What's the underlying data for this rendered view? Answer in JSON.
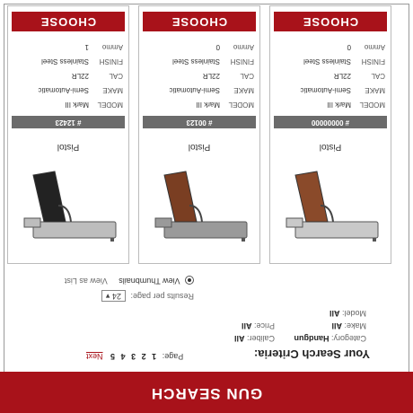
{
  "header": {
    "title": "GUN SEARCH"
  },
  "criteria": {
    "title": "Your Search Criteria:",
    "lines": [
      {
        "label": "Category:",
        "value": "Handgun"
      },
      {
        "label": "Make:",
        "value": "All"
      },
      {
        "label": "Model:",
        "value": "All"
      },
      {
        "label": "Caliber:",
        "value": "All"
      },
      {
        "label": "Price:",
        "value": "All"
      },
      {
        "label": "Results per page:",
        "value": "24"
      }
    ],
    "pager": {
      "label": "Page:",
      "pages": [
        "1",
        "2",
        "3",
        "4",
        "5"
      ],
      "next": "Next"
    },
    "view": {
      "thumbnails": "View Thumbnails",
      "list": "View as List"
    }
  },
  "products": [
    {
      "name": "Pistol",
      "id": "# 00000000",
      "specs": [
        {
          "l": "MODEL",
          "v": "Mark III"
        },
        {
          "l": "MAKE",
          "v": "Semi-Automatic"
        },
        {
          "l": "CAL",
          "v": "22LR"
        },
        {
          "l": "FINISH",
          "v": "Stainless Steel"
        },
        {
          "l": "Ammo",
          "v": "0"
        }
      ],
      "choose": "CHOOSE",
      "colors": {
        "body": "#c9c9c9",
        "grip": "#8a4a2a"
      }
    },
    {
      "name": "Pistol",
      "id": "# 00123",
      "specs": [
        {
          "l": "MODEL",
          "v": "Mark III"
        },
        {
          "l": "MAKE",
          "v": "Semi-Automatic"
        },
        {
          "l": "CAL",
          "v": "22LR"
        },
        {
          "l": "FINISH",
          "v": "Stainless Steel"
        },
        {
          "l": "Ammo",
          "v": "0"
        }
      ],
      "choose": "CHOOSE",
      "colors": {
        "body": "#9a9a9a",
        "grip": "#7a3e22"
      }
    },
    {
      "name": "Pistol",
      "id": "# 12423",
      "specs": [
        {
          "l": "MODEL",
          "v": "Mark III"
        },
        {
          "l": "MAKE",
          "v": "Semi-Automatic"
        },
        {
          "l": "CAL",
          "v": "22LR"
        },
        {
          "l": "FINISH",
          "v": "Stainless Steel"
        },
        {
          "l": "Ammo",
          "v": "1"
        }
      ],
      "choose": "CHOOSE",
      "colors": {
        "body": "#bdbdbd",
        "grip": "#222222"
      }
    }
  ],
  "colors": {
    "accent": "#a8121a",
    "id_bar": "#6b6b6b"
  }
}
